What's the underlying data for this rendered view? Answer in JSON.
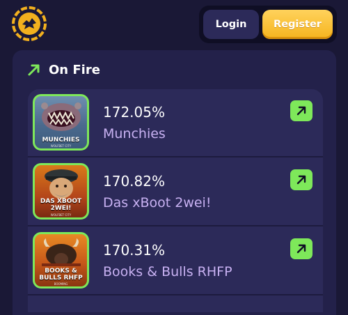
{
  "header": {
    "logo_icon": "coin-logo-icon",
    "login_label": "Login",
    "register_label": "Register"
  },
  "section": {
    "title": "On Fire",
    "icon": "trending-up-icon",
    "accent": "#7ee85a"
  },
  "games": [
    {
      "percent": "172.05%",
      "name": "Munchies",
      "thumb_title": "MUNCHIES",
      "thumb_maker": "WOLFBET CITY",
      "open_icon": "arrow-up-right-icon"
    },
    {
      "percent": "170.82%",
      "name": "Das xBoot 2wei!",
      "thumb_title": "DAS XBOOT 2WEI!",
      "thumb_maker": "WOLFBET CITY",
      "open_icon": "arrow-up-right-icon"
    },
    {
      "percent": "170.31%",
      "name": "Books & Bulls RHFP",
      "thumb_title": "BOOKS & BULLS RHFP",
      "thumb_maker": "BOOMING",
      "open_icon": "arrow-up-right-icon"
    }
  ],
  "colors": {
    "background": "#1a1836",
    "panel": "#23214a",
    "card": "#2c2a59",
    "register": "#f5b41e",
    "game_name": "#c8b1f2"
  }
}
